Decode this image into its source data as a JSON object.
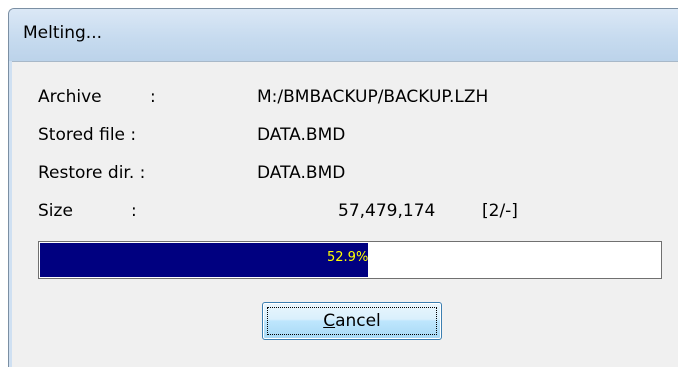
{
  "window": {
    "title": "Melting..."
  },
  "fields": {
    "archive": {
      "label": "Archive",
      "colon": ":",
      "value": "M:/BMBACKUP/BACKUP.LZH"
    },
    "stored_file": {
      "label": "Stored file :",
      "value": "DATA.BMD"
    },
    "restore_dir": {
      "label": "Restore dir. :",
      "value": "DATA.BMD"
    },
    "size": {
      "label": "Size",
      "colon": ":",
      "value": "57,479,174",
      "count": "[2/-]"
    }
  },
  "progress": {
    "percent": 52.9,
    "text": "52.9%",
    "fill_color": "#000080",
    "text_color": "#ffff00"
  },
  "buttons": {
    "cancel_label": "Cancel"
  }
}
